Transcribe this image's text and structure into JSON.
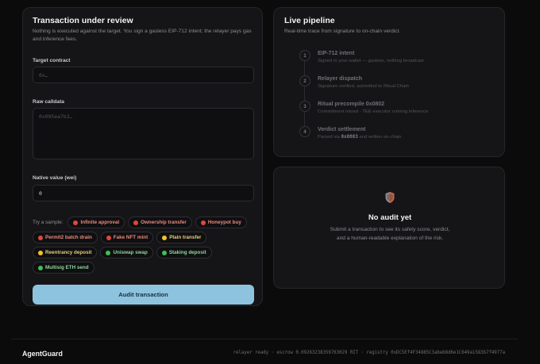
{
  "form": {
    "title": "Transaction under review",
    "subtitle": "Nothing is executed against the target. You sign a gasless EIP-712 intent; the relayer pays gas and inference fees.",
    "target_label": "Target contract",
    "target_placeholder": "0x…",
    "calldata_label": "Raw calldata",
    "calldata_placeholder": "0x095ea7b3…",
    "value_label": "Native value (wei)",
    "value": "0",
    "samples_label": "Try a sample:",
    "samples": [
      {
        "label": "Infinite approval",
        "status": "red"
      },
      {
        "label": "Ownership transfer",
        "status": "red"
      },
      {
        "label": "Honeypot buy",
        "status": "red"
      },
      {
        "label": "Permit2 batch drain",
        "status": "red"
      },
      {
        "label": "Fake NFT mint",
        "status": "red"
      },
      {
        "label": "Plain transfer",
        "status": "yellow"
      },
      {
        "label": "Reentrancy deposit",
        "status": "yellow"
      },
      {
        "label": "Uniswap swap",
        "status": "green"
      },
      {
        "label": "Staking deposit",
        "status": "green"
      },
      {
        "label": "Multisig ETH send",
        "status": "green"
      }
    ],
    "submit_label": "Audit transaction"
  },
  "pipeline": {
    "title": "Live pipeline",
    "subtitle": "Real-time trace from signature to on-chain verdict.",
    "steps": [
      {
        "num": "1",
        "title": "EIP-712 intent",
        "desc": "Signed in your wallet — gasless, nothing broadcast"
      },
      {
        "num": "2",
        "title": "Relayer dispatch",
        "desc": "Signature verified, submitted to Ritual Chain"
      },
      {
        "num": "3",
        "title": "Ritual precompile 0x0802",
        "desc": "Commitment mined · TEE executor running inference"
      },
      {
        "num": "4",
        "title": "Verdict settlement",
        "desc_pre": "Parsed via",
        "desc_code": "0x0803",
        "desc_post": "and written on-chain"
      }
    ]
  },
  "audit": {
    "icon": "shield-icon",
    "title": "No audit yet",
    "desc_line1": "Submit a transaction to see its safety score, verdict,",
    "desc_line2": "and a human-readable explanation of the risk."
  },
  "footer": {
    "brand": "AgentGuard",
    "status": "relayer ready · escrow 0.09263238359763029 RIT · registry 0xDC5Ef4F34885C3abeb8d6e1C649a1583b7f4977a"
  },
  "colors": {
    "accent": "#8ec3df",
    "danger": "#e0473b",
    "warning": "#f2c230",
    "safe": "#3fbf55"
  }
}
